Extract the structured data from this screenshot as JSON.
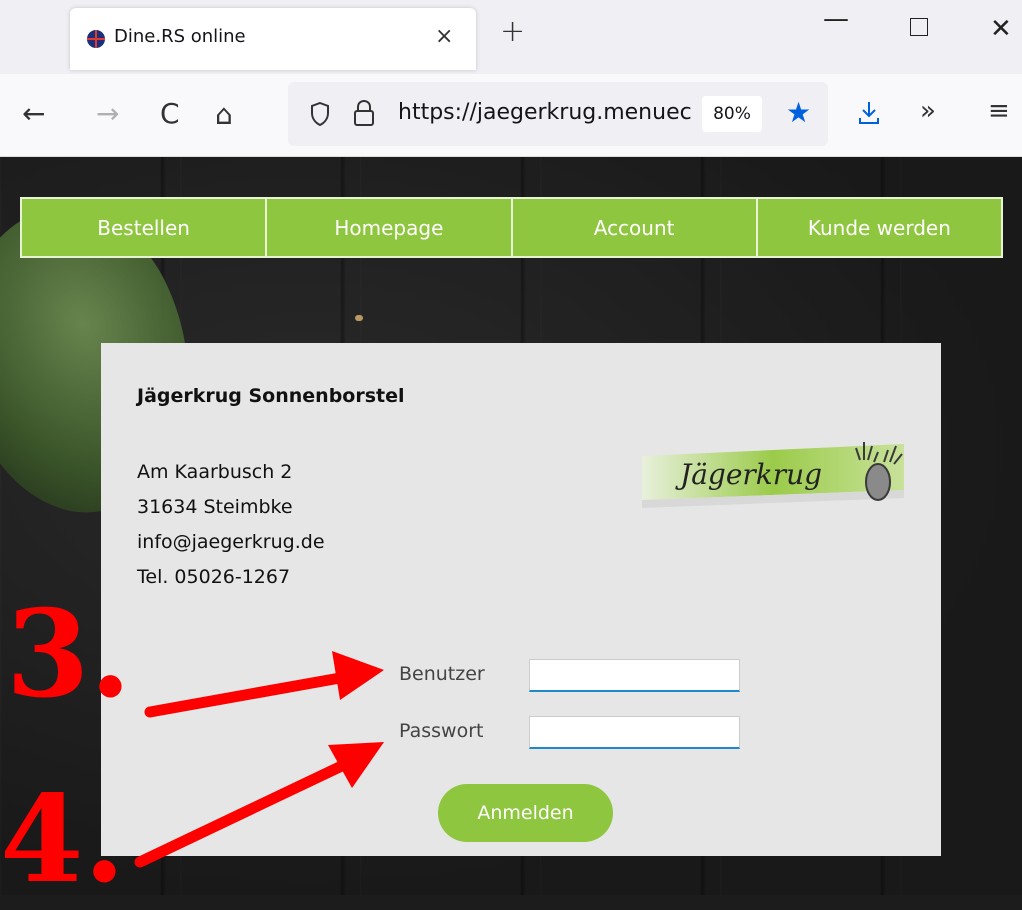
{
  "browser": {
    "tab_title": "Dine.RS online",
    "tab_close": "×",
    "new_tab": "+",
    "window_min": "—",
    "window_close": "✕",
    "nav_back": "←",
    "nav_forward": "→",
    "nav_reload": "C",
    "nav_home": "⌂",
    "url": "https://jaegerkrug.menuec",
    "zoom": "80%",
    "bookmark_star": "★",
    "overflow": "»",
    "menu": "≡"
  },
  "nav": {
    "items": [
      {
        "label": "Bestellen"
      },
      {
        "label": "Homepage"
      },
      {
        "label": "Account"
      },
      {
        "label": "Kunde werden"
      }
    ]
  },
  "restaurant": {
    "name": "Jägerkrug Sonnenborstel",
    "street": "Am Kaarbusch 2",
    "city": "31634 Steimbke",
    "email": "info@jaegerkrug.de",
    "phone": "Tel. 05026-1267",
    "logo_text": "Jägerkrug"
  },
  "login": {
    "user_label": "Benutzer",
    "user_value": "",
    "password_label": "Passwort",
    "password_value": "",
    "submit_label": "Anmelden"
  },
  "annotations": {
    "step3": "3.",
    "step4": "4."
  },
  "colors": {
    "accent_green": "#8ec63f",
    "annotation_red": "#ff0000",
    "input_underline": "#1e88c8",
    "bookmark_blue": "#0061e0"
  }
}
